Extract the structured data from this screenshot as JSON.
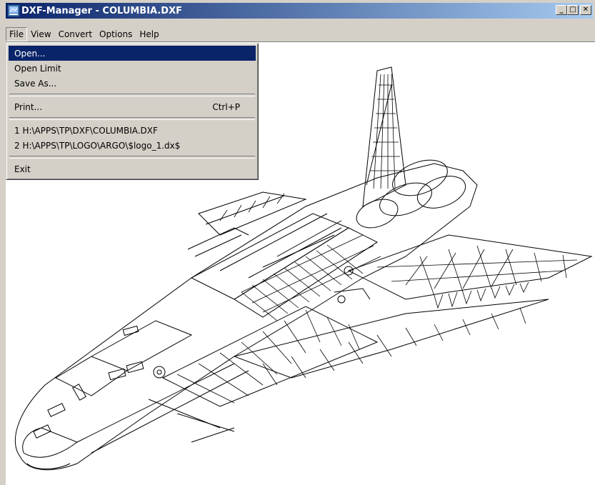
{
  "window": {
    "title": "DXF-Manager  -  COLUMBIA.DXF",
    "minimize": "_",
    "maximize": "□",
    "close": "✕"
  },
  "menubar": {
    "items": [
      "File",
      "View",
      "Convert",
      "Options",
      "Help"
    ]
  },
  "file_menu": {
    "open": "Open...",
    "open_limit": "Open Limit",
    "save_as": "Save As...",
    "print": "Print...",
    "print_accel": "Ctrl+P",
    "recent_1": "1 H:\\APPS\\TP\\DXF\\COLUMBIA.DXF",
    "recent_2": "2 H:\\APPS\\TP\\LOGO\\ARGO\\$logo_1.dx$",
    "exit": "Exit"
  },
  "drawing": {
    "subject": "space-shuttle-wireframe"
  },
  "colors": {
    "title_start": "#0a246a",
    "title_end": "#a6caf0",
    "highlight": "#0a246a",
    "face": "#d4d0c8"
  }
}
